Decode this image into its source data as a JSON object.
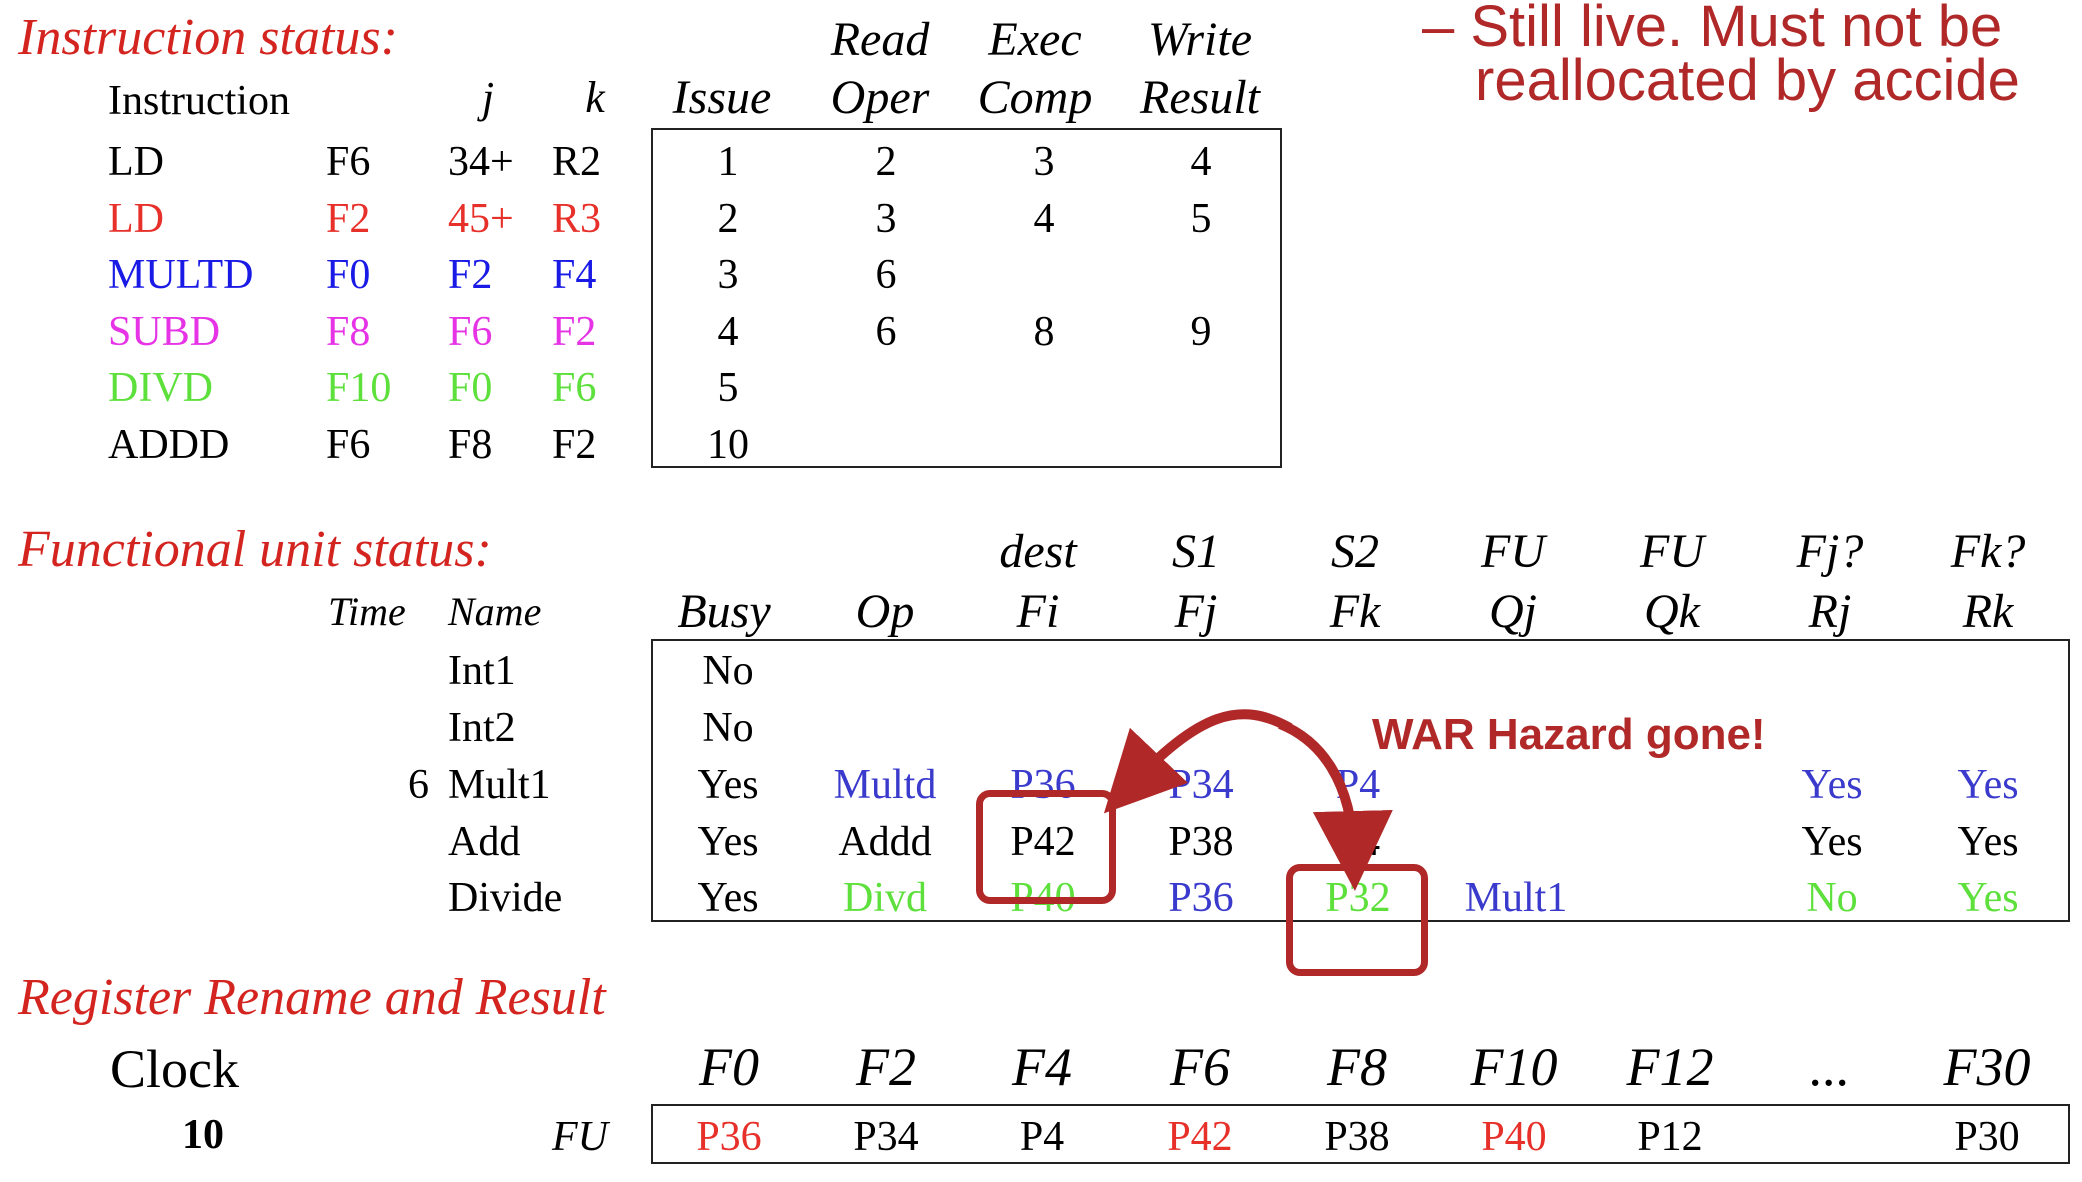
{
  "sections": {
    "instruction_status": "Instruction status:",
    "fu_status": "Functional unit status:",
    "register_rename": "Register Rename and Result"
  },
  "note": {
    "line1": "– Still live.  Must not be",
    "line2": "reallocated by accide"
  },
  "instr_headers": {
    "instruction": "Instruction",
    "j": "j",
    "k": "k",
    "read_top": "Read",
    "exec_top": "Exec",
    "write_top": "Write",
    "issue": "Issue",
    "oper": "Oper",
    "comp": "Comp",
    "result": "Result"
  },
  "instructions": [
    {
      "op": "LD",
      "dest": "F6",
      "j": "34+",
      "k": "R2",
      "issue": "1",
      "read": "2",
      "exec": "3",
      "write": "4",
      "color": "#000000"
    },
    {
      "op": "LD",
      "dest": "F2",
      "j": "45+",
      "k": "R3",
      "issue": "2",
      "read": "3",
      "exec": "4",
      "write": "5",
      "color": "#e8302a"
    },
    {
      "op": "MULTD",
      "dest": "F0",
      "j": "F2",
      "k": "F4",
      "issue": "3",
      "read": "6",
      "exec": "",
      "write": "",
      "color": "#1a1ae6"
    },
    {
      "op": "SUBD",
      "dest": "F8",
      "j": "F6",
      "k": "F2",
      "issue": "4",
      "read": "6",
      "exec": "8",
      "write": "9",
      "color": "#e633e6"
    },
    {
      "op": "DIVD",
      "dest": "F10",
      "j": "F0",
      "k": "F6",
      "issue": "5",
      "read": "",
      "exec": "",
      "write": "",
      "color": "#5ee03c"
    },
    {
      "op": "ADDD",
      "dest": "F6",
      "j": "F8",
      "k": "F2",
      "issue": "10",
      "read": "",
      "exec": "",
      "write": "",
      "color": "#000000"
    }
  ],
  "fu_headers": {
    "dest": "dest",
    "s1": "S1",
    "s2": "S2",
    "fu1": "FU",
    "fu2": "FU",
    "fjq": "Fj?",
    "fkq": "Fk?",
    "time": "Time",
    "name": "Name",
    "busy": "Busy",
    "op": "Op",
    "fi": "Fi",
    "fj": "Fj",
    "fk": "Fk",
    "qj": "Qj",
    "qk": "Qk",
    "rj": "Rj",
    "rk": "Rk"
  },
  "fu_rows": [
    {
      "time": "",
      "name": "Int1",
      "busy": "No",
      "op": "",
      "fi": "",
      "fj": "",
      "fk": "",
      "qj": "",
      "qk": "",
      "rj": "",
      "rk": ""
    },
    {
      "time": "",
      "name": "Int2",
      "busy": "No",
      "op": "",
      "fi": "",
      "fj": "",
      "fk": "",
      "qj": "",
      "qk": "",
      "rj": "",
      "rk": ""
    },
    {
      "time": "6",
      "name": "Mult1",
      "busy": "Yes",
      "op": "Multd",
      "fi": "P36",
      "fj": "P34",
      "fk": "P4",
      "qj": "",
      "qk": "",
      "rj": "Yes",
      "rk": "Yes"
    },
    {
      "time": "",
      "name": "Add",
      "busy": "Yes",
      "op": "Addd",
      "fi": "P42",
      "fj": "P38",
      "fk": "P4",
      "qj": "",
      "qk": "",
      "rj": "Yes",
      "rk": "Yes"
    },
    {
      "time": "",
      "name": "Divide",
      "busy": "Yes",
      "op": "Divd",
      "fi": "P40",
      "fj": "P36",
      "fk": "P32",
      "qj": "Mult1",
      "qk": "",
      "rj": "No",
      "rk": "Yes"
    }
  ],
  "annotation": "WAR Hazard gone!",
  "reg": {
    "clock_label": "Clock",
    "clock_value": "10",
    "fu_label": "FU",
    "registers": [
      {
        "name": "F0",
        "value": "P36",
        "color": "#e8302a"
      },
      {
        "name": "F2",
        "value": "P34",
        "color": "#000000"
      },
      {
        "name": "F4",
        "value": "P4",
        "color": "#000000"
      },
      {
        "name": "F6",
        "value": "P42",
        "color": "#e8302a"
      },
      {
        "name": "F8",
        "value": "P38",
        "color": "#000000"
      },
      {
        "name": "F10",
        "value": "P40",
        "color": "#e8302a"
      },
      {
        "name": "F12",
        "value": "P12",
        "color": "#000000"
      },
      {
        "name": "...",
        "value": "",
        "color": "#000000"
      },
      {
        "name": "F30",
        "value": "P30",
        "color": "#000000"
      }
    ]
  }
}
